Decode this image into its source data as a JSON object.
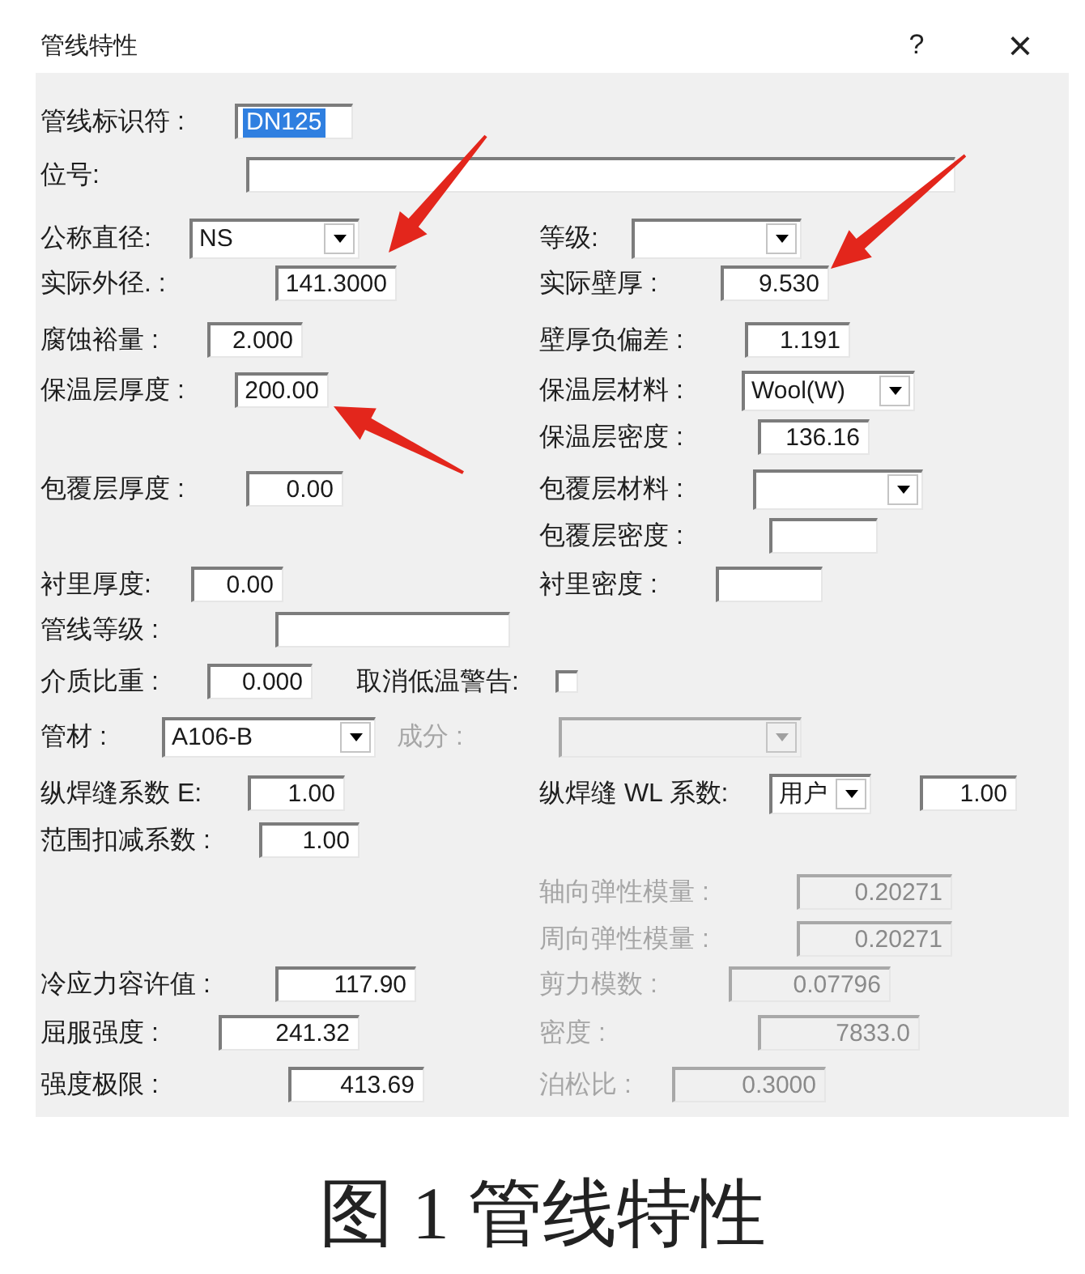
{
  "window": {
    "title": "管线特性",
    "help_button": "?",
    "close_button": "×"
  },
  "rows": [
    {
      "items": [
        {
          "kind": "text",
          "label": "管线标识符 :",
          "value": "DN125",
          "highlighted": true,
          "disabled": false
        }
      ]
    },
    {
      "items": [
        {
          "kind": "text",
          "label": "位号:",
          "disabled": false
        }
      ]
    },
    {
      "items": [
        {
          "kind": "combo",
          "label": "公称直径:",
          "value": "NS",
          "disabled": false
        },
        {
          "kind": "combo",
          "label": "等级:",
          "disabled": false
        }
      ]
    },
    {
      "items": [
        {
          "kind": "text",
          "label": "实际外径. :",
          "value": "141.3000",
          "highlighted": false,
          "disabled": false
        },
        {
          "kind": "text",
          "label": "实际壁厚 :",
          "value": "9.530",
          "highlighted": false,
          "disabled": false
        }
      ]
    },
    {
      "items": [
        {
          "kind": "text",
          "label": "腐蚀裕量 :",
          "value": "2.000",
          "highlighted": false,
          "disabled": false
        },
        {
          "kind": "text",
          "label": "壁厚负偏差 :",
          "value": "1.191",
          "highlighted": false,
          "disabled": false
        }
      ]
    },
    {
      "items": [
        {
          "kind": "text",
          "label": "保温层厚度 :",
          "value": "200.00",
          "highlighted": false,
          "disabled": false
        },
        {
          "kind": "combo",
          "label": "保温层材料 :",
          "value": "Wool(W)",
          "disabled": false
        }
      ]
    },
    {
      "items": [
        {
          "kind": "text",
          "label": "保温层密度 :",
          "value": "136.16",
          "highlighted": false,
          "disabled": false
        }
      ]
    },
    {
      "items": [
        {
          "kind": "text",
          "label": "包覆层厚度 :",
          "value": "0.00",
          "highlighted": false,
          "disabled": false
        },
        {
          "kind": "combo",
          "label": "包覆层材料 :",
          "disabled": false
        }
      ]
    },
    {
      "items": [
        {
          "kind": "text",
          "label": "包覆层密度 :",
          "disabled": false
        }
      ]
    },
    {
      "items": [
        {
          "kind": "text",
          "label": "衬里厚度:",
          "value": "0.00",
          "highlighted": false,
          "disabled": false
        },
        {
          "kind": "text",
          "label": "衬里密度 :",
          "disabled": false
        }
      ]
    },
    {
      "items": [
        {
          "kind": "text",
          "label": "管线等级 :",
          "disabled": false
        }
      ]
    },
    {
      "items": [
        {
          "kind": "text",
          "label": "介质比重 :",
          "value": "0.000",
          "highlighted": false,
          "disabled": false
        },
        {
          "kind": "check",
          "label": "取消低温警告:",
          "checked": false,
          "disabled": false
        }
      ]
    },
    {
      "items": [
        {
          "kind": "combo",
          "label": "管材 :",
          "value": "A106-B",
          "disabled": false
        },
        {
          "kind": "combo",
          "label": "成分 :",
          "disabled": true
        }
      ]
    },
    {
      "items": [
        {
          "kind": "text",
          "label": "纵焊缝系数 E:",
          "value": "1.00",
          "highlighted": false,
          "disabled": false
        },
        {
          "kind": "combo",
          "label": "纵焊缝 WL 系数:",
          "value": "用户",
          "disabled": false
        },
        {
          "kind": "text",
          "value": "1.00",
          "highlighted": false,
          "disabled": false
        }
      ]
    },
    {
      "items": [
        {
          "kind": "text",
          "label": "范围扣减系数 :",
          "value": "1.00",
          "highlighted": false,
          "disabled": false
        }
      ]
    },
    {
      "items": [
        {
          "kind": "text",
          "label": "轴向弹性模量 :",
          "value": "0.20271",
          "highlighted": false,
          "disabled": true
        }
      ]
    },
    {
      "items": [
        {
          "kind": "text",
          "label": "周向弹性模量 :",
          "value": "0.20271",
          "highlighted": false,
          "disabled": true
        }
      ]
    },
    {
      "items": [
        {
          "kind": "text",
          "label": "冷应力容许值 :",
          "value": "117.90",
          "highlighted": false,
          "disabled": false
        },
        {
          "kind": "text",
          "label": "剪力模数 :",
          "value": "0.07796",
          "highlighted": false,
          "disabled": true
        }
      ]
    },
    {
      "items": [
        {
          "kind": "text",
          "label": "屈服强度 :",
          "value": "241.32",
          "highlighted": false,
          "disabled": false
        },
        {
          "kind": "text",
          "label": "密度 :",
          "value": "7833.0",
          "highlighted": false,
          "disabled": true
        }
      ]
    },
    {
      "items": [
        {
          "kind": "text",
          "label": "强度极限 :",
          "value": "413.69",
          "highlighted": false,
          "disabled": false
        },
        {
          "kind": "text",
          "label": "泊松比 :",
          "value": "0.3000",
          "highlighted": false,
          "disabled": true
        }
      ]
    }
  ],
  "caption": "图 1 管线特性"
}
